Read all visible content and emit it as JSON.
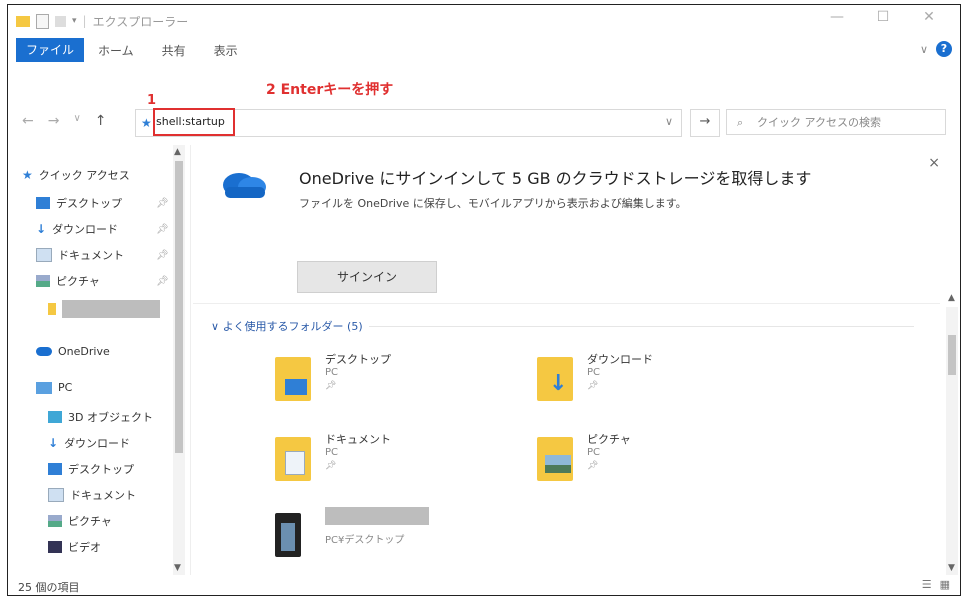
{
  "window": {
    "title": "エクスプローラー",
    "controls": [
      "—",
      "☐",
      "✕"
    ]
  },
  "ribbon": {
    "tabs": [
      "ファイル",
      "ホーム",
      "共有",
      "表示"
    ]
  },
  "annotations": {
    "step1": "1",
    "step2": "2 Enterキーを押す"
  },
  "address_bar": {
    "value": "shell:startup",
    "go_symbol": "→"
  },
  "search": {
    "placeholder": "クイック アクセスの検索"
  },
  "sidebar": {
    "quick_access": "クイック アクセス",
    "quick_items": [
      "デスクトップ",
      "ダウンロード",
      "ドキュメント",
      "ピクチャ"
    ],
    "onedrive": "OneDrive",
    "pc": "PC",
    "pc_items": [
      "3D オブジェクト",
      "ダウンロード",
      "デスクトップ",
      "ドキュメント",
      "ピクチャ",
      "ビデオ"
    ]
  },
  "banner": {
    "title": "OneDrive にサインインして 5 GB のクラウドストレージを取得します",
    "subtitle": "ファイルを OneDrive に保存し、モバイルアプリから表示および編集します。",
    "signin_label": "サインイン",
    "close": "×"
  },
  "section": {
    "title": "よく使用するフォルダー (5)"
  },
  "folders": [
    {
      "name": "デスクトップ",
      "location": "PC"
    },
    {
      "name": "ダウンロード",
      "location": "PC"
    },
    {
      "name": "ドキュメント",
      "location": "PC"
    },
    {
      "name": "ピクチャ",
      "location": "PC"
    },
    {
      "name": "",
      "location": "PC¥デスクトップ"
    }
  ],
  "status": {
    "item_count": "25 個の項目"
  },
  "colors": {
    "accent": "#1a6fd0",
    "annotation": "#e03030"
  }
}
